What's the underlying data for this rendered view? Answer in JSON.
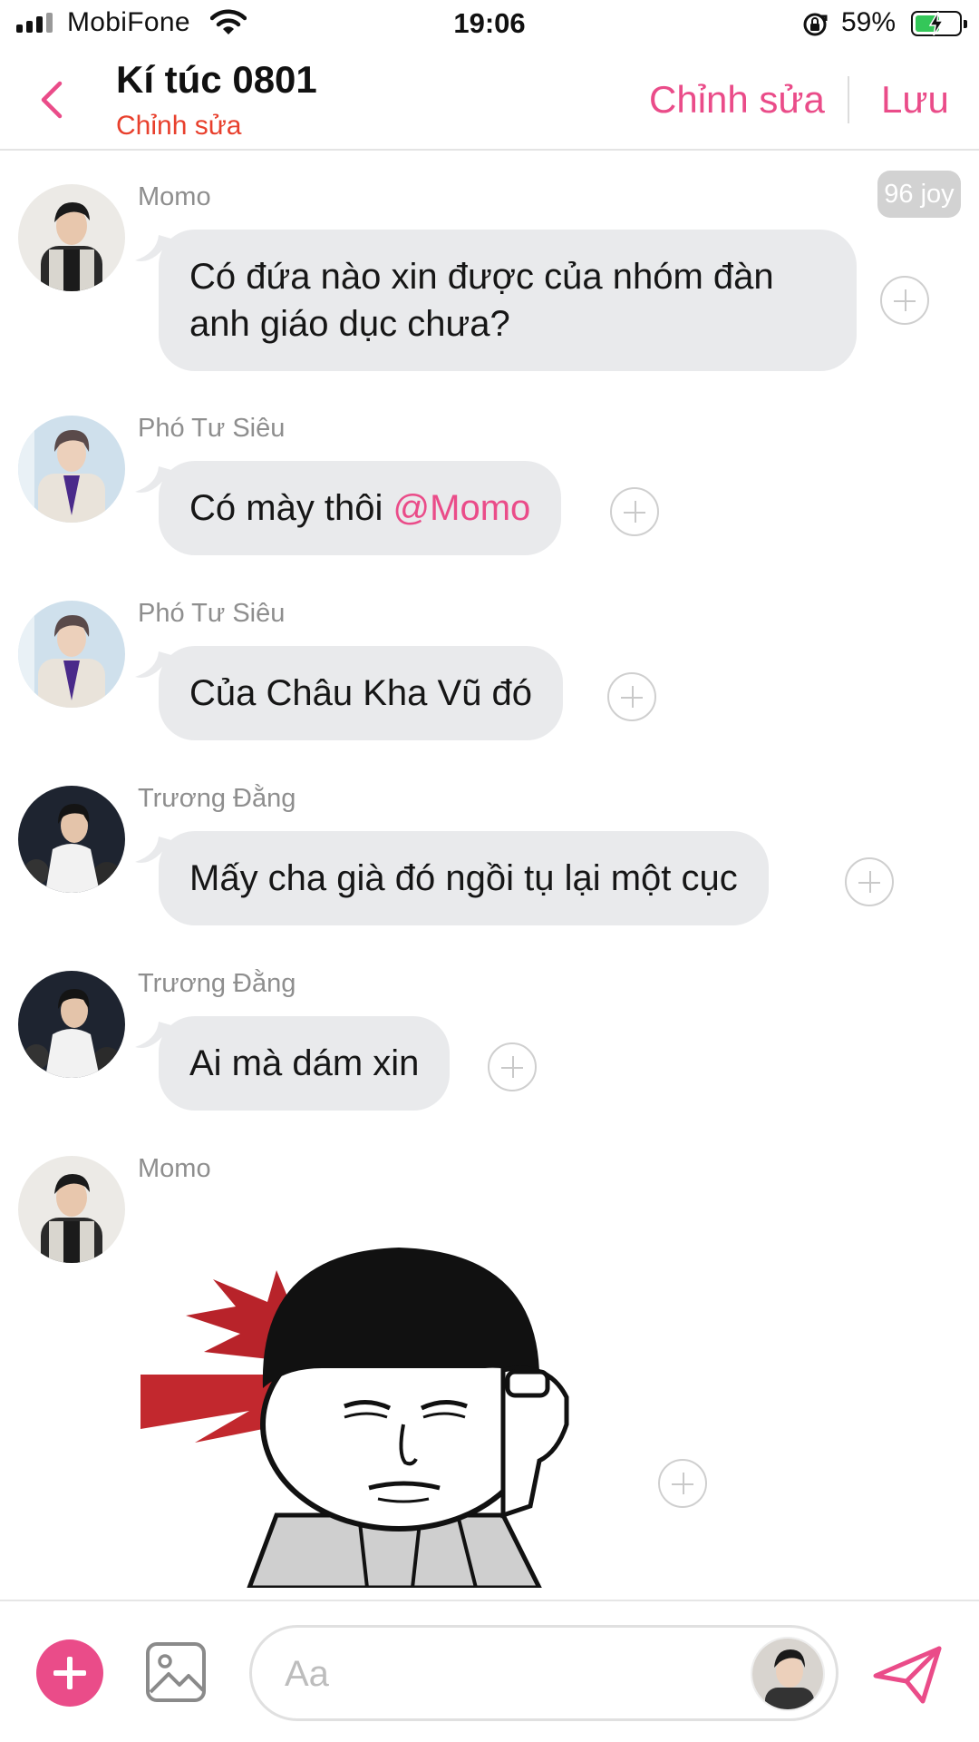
{
  "status_bar": {
    "carrier": "MobiFone",
    "time": "19:06",
    "battery_percent": "59%",
    "battery_level": 0.59,
    "battery_color": "#34c759"
  },
  "header": {
    "title": "Kí túc 0801",
    "subtitle": "Chỉnh sửa",
    "edit_label": "Chỉnh sửa",
    "save_label": "Lưu",
    "accent_color": "#ea4c89",
    "subtitle_color": "#e8402d"
  },
  "joy_badge": "96 joy",
  "messages": [
    {
      "sender": "Momo",
      "avatar": "avatar-momo",
      "text": "Có đứa nào xin được của nhóm đàn anh giáo dục chưa?"
    },
    {
      "sender": "Phó Tư Siêu",
      "avatar": "avatar-pho-tu-sieu",
      "text": "Có mày thôi ",
      "mention": "@Momo"
    },
    {
      "sender": "Phó Tư Siêu",
      "avatar": "avatar-pho-tu-sieu",
      "text": "Của Châu Kha Vũ đó"
    },
    {
      "sender": "Trương Đằng",
      "avatar": "avatar-truong-dang",
      "text": "Mấy cha già đó ngồi tụ lại một cục"
    },
    {
      "sender": "Trương Đằng",
      "avatar": "avatar-truong-dang",
      "text": "Ai mà dám xin"
    },
    {
      "sender": "Momo",
      "avatar": "avatar-momo",
      "sticker": "bowl-cut-face-sticker"
    }
  ],
  "composer": {
    "placeholder": "Aa",
    "value": ""
  },
  "icons": {
    "back": "chevron-left-icon",
    "add": "plus-icon",
    "image": "image-icon",
    "send": "send-icon",
    "react": "add-reaction-icon"
  }
}
